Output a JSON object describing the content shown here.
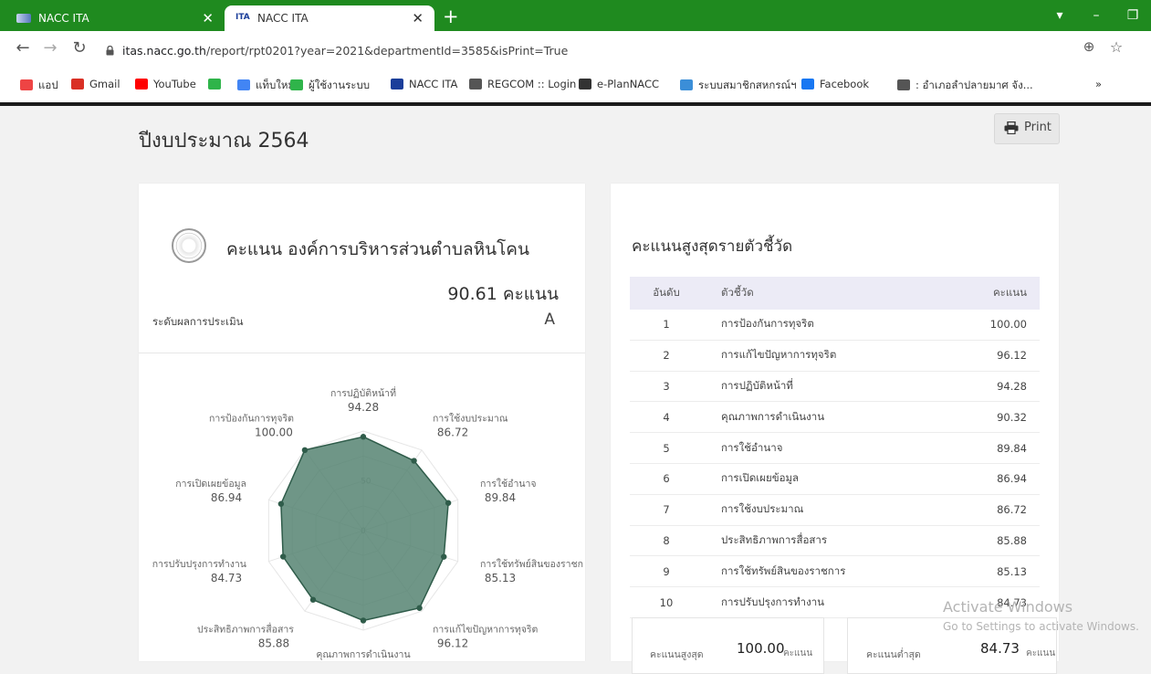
{
  "browser": {
    "tabs": [
      {
        "title": "NACC ITA",
        "active": false
      },
      {
        "title": "NACC ITA",
        "active": true
      }
    ],
    "favicon_text": "ITA",
    "url_host": "itas.nacc.go.th",
    "url_path": "/report/rpt0201?year=2021&departmentId=3585&isPrint=True",
    "bookmarks": [
      {
        "label": "แอป",
        "icon": "apps-grid-icon",
        "color": "#e44"
      },
      {
        "label": "Gmail",
        "icon": "gmail-icon",
        "color": "#d93025"
      },
      {
        "label": "YouTube",
        "icon": "youtube-icon",
        "color": "#f00"
      },
      {
        "label": "",
        "icon": "green-s-icon",
        "color": "#2fb44a"
      },
      {
        "label": "แท็บใหม่",
        "icon": "google-icon",
        "color": "#4285f4"
      },
      {
        "label": "ผู้ใช้งานระบบ",
        "icon": "green-s-icon",
        "color": "#2fb44a"
      },
      {
        "label": "NACC ITA",
        "icon": "ita-icon",
        "color": "#1b3e9a"
      },
      {
        "label": "REGCOM :: Login",
        "icon": "globe-icon",
        "color": "#555"
      },
      {
        "label": "e-PlanNACC",
        "icon": "home-icon",
        "color": "#333"
      },
      {
        "label": "ระบบสมาชิกสหกรณ์ฯ",
        "icon": "coop-icon",
        "color": "#3b8ed8"
      },
      {
        "label": "Facebook",
        "icon": "facebook-icon",
        "color": "#1877f2"
      },
      {
        "label": ": อำเภอลำปลายมาศ จัง...",
        "icon": "globe-icon",
        "color": "#555"
      }
    ],
    "bookmarks_more": "»"
  },
  "page": {
    "heading": "ปีงบประมาณ 2564",
    "print_label": "Print"
  },
  "score_card": {
    "heading": "คะแนน องค์การบริหารส่วนตำบลหินโคน",
    "total": "90.61 คะแนน",
    "grade_label": "ระดับผลการประเมิน",
    "grade": "A"
  },
  "chart_data": {
    "type": "radar",
    "rmax": 100,
    "ticks": [
      "0",
      "50"
    ],
    "axes": [
      {
        "label": "การปฏิบัติหน้าที่",
        "value": 94.28,
        "display": "94.28"
      },
      {
        "label": "การใช้งบประมาณ",
        "value": 86.72,
        "display": "86.72"
      },
      {
        "label": "การใช้อำนาจ",
        "value": 89.84,
        "display": "89.84"
      },
      {
        "label": "การใช้ทรัพย์สินของราชก",
        "value": 85.13,
        "display": "85.13"
      },
      {
        "label": "การแก้ไขปัญหาการทุจริต",
        "value": 96.12,
        "display": "96.12"
      },
      {
        "label": "คุณภาพการดำเนินงาน",
        "value": 90.32,
        "display": "90.32"
      },
      {
        "label": "ประสิทธิภาพการสื่อสาร",
        "value": 85.88,
        "display": "85.88"
      },
      {
        "label": "การปรับปรุงการทำงาน",
        "value": 84.73,
        "display": "84.73"
      },
      {
        "label": "การเปิดเผยข้อมูล",
        "value": 86.94,
        "display": "86.94"
      },
      {
        "label": "การป้องกันการทุจริต",
        "value": 100.0,
        "display": "100.00"
      }
    ],
    "fill_color": "#4f7f6c",
    "line_color": "#2f5c4a"
  },
  "ranking": {
    "title": "คะแนนสูงสุดรายตัวชี้วัด",
    "headers": {
      "rank": "อันดับ",
      "name": "ตัวชี้วัด",
      "score": "คะแนน"
    },
    "rows": [
      {
        "rank": "1",
        "name": "การป้องกันการทุจริต",
        "score": "100.00"
      },
      {
        "rank": "2",
        "name": "การแก้ไขปัญหาการทุจริต",
        "score": "96.12"
      },
      {
        "rank": "3",
        "name": "การปฏิบัติหน้าที่",
        "score": "94.28"
      },
      {
        "rank": "4",
        "name": "คุณภาพการดำเนินงาน",
        "score": "90.32"
      },
      {
        "rank": "5",
        "name": "การใช้อำนาจ",
        "score": "89.84"
      },
      {
        "rank": "6",
        "name": "การเปิดเผยข้อมูล",
        "score": "86.94"
      },
      {
        "rank": "7",
        "name": "การใช้งบประมาณ",
        "score": "86.72"
      },
      {
        "rank": "8",
        "name": "ประสิทธิภาพการสื่อสาร",
        "score": "85.88"
      },
      {
        "rank": "9",
        "name": "การใช้ทรัพย์สินของราชการ",
        "score": "85.13"
      },
      {
        "rank": "10",
        "name": "การปรับปรุงการทำงาน",
        "score": "84.73"
      }
    ]
  },
  "stats": {
    "max_label": "คะแนนสูงสุด",
    "max_value": "100.00",
    "max_unit": "คะแนน",
    "min_label": "คะแนนต่ำสุด",
    "min_value": "84.73",
    "min_unit": "คะแนน"
  },
  "watermark": {
    "title": "Activate Windows",
    "subtitle": "Go to Settings to activate Windows."
  }
}
